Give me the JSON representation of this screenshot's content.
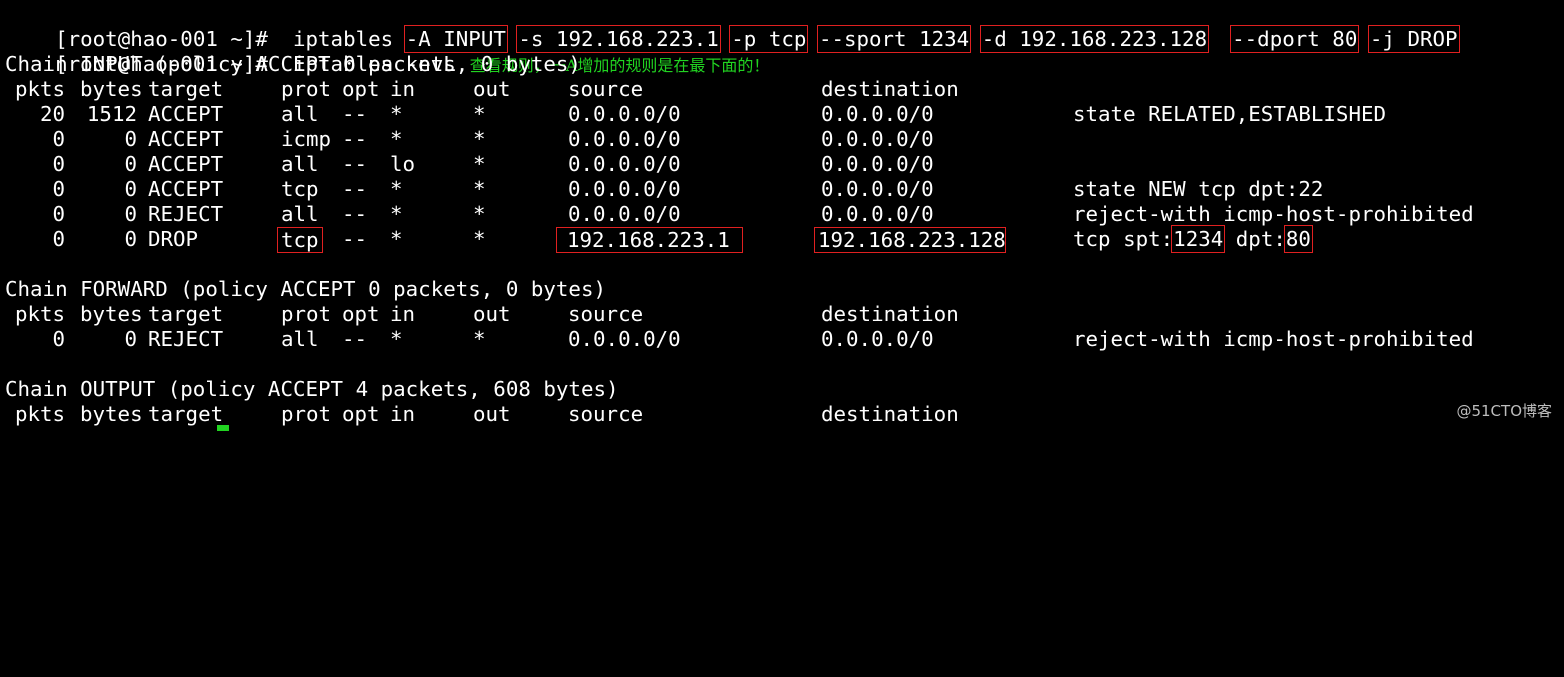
{
  "prompt": "[root@hao-001 ~]#",
  "command1": {
    "base": "iptables",
    "args": [
      "-A INPUT",
      "-s 192.168.223.1",
      "-p tcp",
      "--sport 1234",
      "-d 192.168.223.128",
      "--dport 80",
      "-j DROP"
    ]
  },
  "command2": {
    "text": "iptables -nvL",
    "note": "查看规则，一A增加的规则是在最下面的！"
  },
  "header": {
    "pkts": "pkts",
    "bytes": "bytes",
    "target": "target",
    "prot": "prot",
    "opt": "opt",
    "in": "in",
    "out": "out",
    "source": "source",
    "destination": "destination"
  },
  "chains": [
    {
      "title": "Chain INPUT (policy ACCEPT 0 packets, 0 bytes)",
      "rules": [
        {
          "pkts": "20",
          "bytes": "1512",
          "target": "ACCEPT",
          "prot": "all",
          "opt": "--",
          "in": "*",
          "out": "*",
          "source": "0.0.0.0/0",
          "destination": "0.0.0.0/0",
          "extra": "state RELATED,ESTABLISHED"
        },
        {
          "pkts": "0",
          "bytes": "0",
          "target": "ACCEPT",
          "prot": "icmp",
          "opt": "--",
          "in": "*",
          "out": "*",
          "source": "0.0.0.0/0",
          "destination": "0.0.0.0/0",
          "extra": ""
        },
        {
          "pkts": "0",
          "bytes": "0",
          "target": "ACCEPT",
          "prot": "all",
          "opt": "--",
          "in": "lo",
          "out": "*",
          "source": "0.0.0.0/0",
          "destination": "0.0.0.0/0",
          "extra": ""
        },
        {
          "pkts": "0",
          "bytes": "0",
          "target": "ACCEPT",
          "prot": "tcp",
          "opt": "--",
          "in": "*",
          "out": "*",
          "source": "0.0.0.0/0",
          "destination": "0.0.0.0/0",
          "extra": "state NEW tcp dpt:22"
        },
        {
          "pkts": "0",
          "bytes": "0",
          "target": "REJECT",
          "prot": "all",
          "opt": "--",
          "in": "*",
          "out": "*",
          "source": "0.0.0.0/0",
          "destination": "0.0.0.0/0",
          "extra": "reject-with icmp-host-prohibited"
        }
      ],
      "drop_rule": {
        "pkts": "0",
        "bytes": "0",
        "target": "DROP",
        "prot": "tcp",
        "opt": "--",
        "in": "*",
        "out": "*",
        "source": "192.168.223.1",
        "destination": "192.168.223.128",
        "extra_a": "tcp spt:",
        "spt": "1234",
        "extra_b": " dpt:",
        "dpt": "80"
      }
    },
    {
      "title": "Chain FORWARD (policy ACCEPT 0 packets, 0 bytes)",
      "rules": [
        {
          "pkts": "0",
          "bytes": "0",
          "target": "REJECT",
          "prot": "all",
          "opt": "--",
          "in": "*",
          "out": "*",
          "source": "0.0.0.0/0",
          "destination": "0.0.0.0/0",
          "extra": "reject-with icmp-host-prohibited"
        }
      ]
    },
    {
      "title": "Chain OUTPUT (policy ACCEPT 4 packets, 608 bytes)",
      "rules": []
    }
  ],
  "watermark": "@51CTO博客",
  "colors": {
    "background": "#000000",
    "text": "#ffffff",
    "note": "#21d321",
    "highlight_box": "#e02020",
    "cursor": "#21d321"
  }
}
